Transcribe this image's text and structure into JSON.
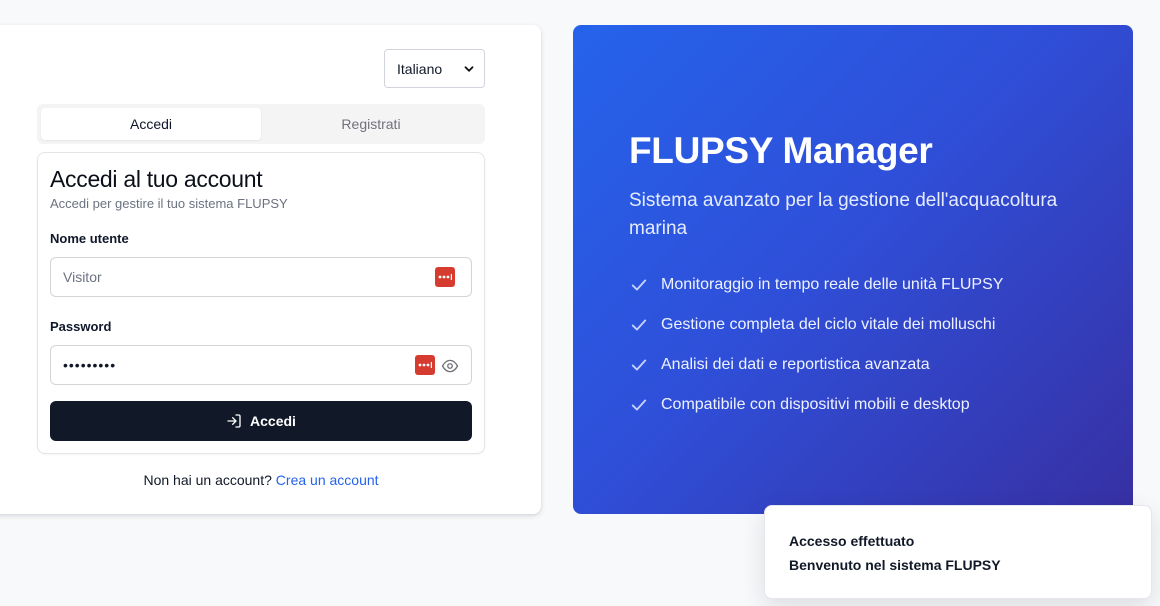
{
  "language_select": {
    "value": "Italiano"
  },
  "tabs": [
    {
      "label": "Accedi",
      "active": true
    },
    {
      "label": "Registrati",
      "active": false
    }
  ],
  "login_form": {
    "title": "Accedi al tuo account",
    "subtitle": "Accedi per gestire il tuo sistema FLUPSY",
    "username_label": "Nome utente",
    "username_value": "Visitor",
    "password_label": "Password",
    "password_masked": "•••••••••",
    "submit_label": "Accedi"
  },
  "signup_prompt": {
    "text": "Non hai un account?",
    "link": "Crea un account"
  },
  "hero": {
    "title": "FLUPSY Manager",
    "subtitle": "Sistema avanzato per la gestione dell'acquacoltura marina",
    "features": [
      "Monitoraggio in tempo reale delle unità FLUPSY",
      "Gestione completa del ciclo vitale dei molluschi",
      "Analisi dei dati e reportistica avanzata",
      "Compatibile con dispositivi mobili e desktop"
    ]
  },
  "toast": {
    "title": "Accesso effettuato",
    "message": "Benvenuto nel sistema FLUPSY"
  },
  "colors": {
    "primary_button": "#111827",
    "link": "#2563eb",
    "hero_gradient_start": "#2563eb",
    "hero_gradient_end": "#3730a3",
    "password_manager_badge": "#d63b30"
  },
  "icons": [
    "chevron-down-icon",
    "password-manager-icon",
    "eye-icon",
    "login-icon",
    "check-icon"
  ]
}
